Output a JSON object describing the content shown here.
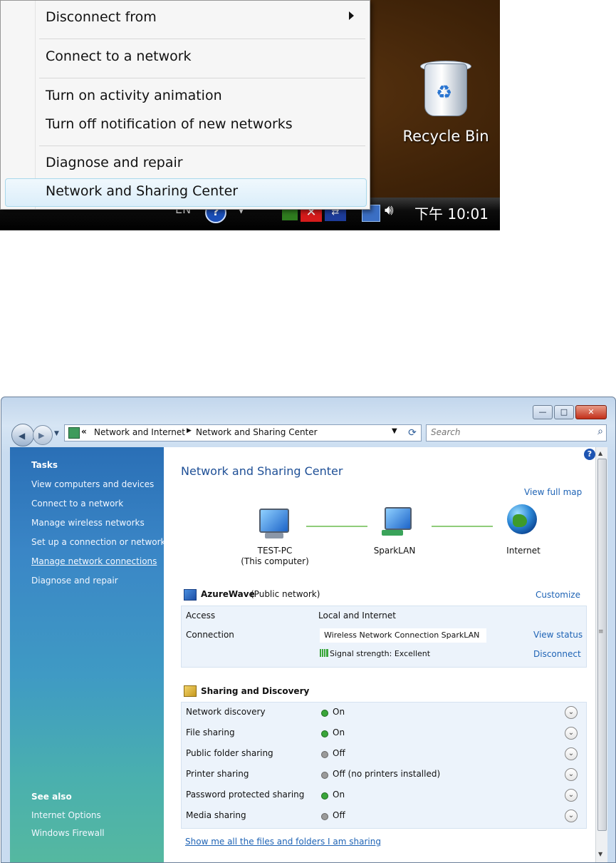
{
  "context_menu": {
    "items": {
      "disconnect_from": "Disconnect from",
      "connect_to_network": "Connect to a network",
      "turn_on_activity": "Turn on activity animation",
      "turn_off_notification": "Turn off notification of new networks",
      "diagnose_repair": "Diagnose and repair",
      "network_sharing_center": "Network and Sharing Center"
    }
  },
  "desktop": {
    "recycle_bin_label": "Recycle Bin"
  },
  "taskbar": {
    "language": "EN",
    "clock": "下午 10:01"
  },
  "window": {
    "address_bar": {
      "crumbs": [
        "Network and Internet",
        "Network and Sharing Center"
      ]
    },
    "search": {
      "placeholder": "Search"
    },
    "sidebar": {
      "tasks_heading": "Tasks",
      "tasks": [
        "View computers and devices",
        "Connect to a network",
        "Manage wireless networks",
        "Set up a connection or network",
        "Manage network connections",
        "Diagnose and repair"
      ],
      "see_also_heading": "See also",
      "see_also": [
        "Internet Options",
        "Windows Firewall"
      ]
    },
    "main": {
      "title": "Network and Sharing Center",
      "view_full_map": "View full map",
      "map_nodes": {
        "computer_name": "TEST-PC",
        "computer_sub": "(This computer)",
        "router": "SparkLAN",
        "internet": "Internet"
      },
      "network": {
        "name": "AzureWave",
        "type": "(Public network)",
        "customize": "Customize",
        "access_label": "Access",
        "access_value": "Local and Internet",
        "connection_label": "Connection",
        "connection_value": "Wireless Network Connection SparkLAN",
        "signal": "Signal strength:  Excellent",
        "view_status": "View status",
        "disconnect": "Disconnect"
      },
      "sharing": {
        "heading": "Sharing and Discovery",
        "rows": [
          {
            "label": "Network discovery",
            "status": "On",
            "state": "on"
          },
          {
            "label": "File sharing",
            "status": "On",
            "state": "on"
          },
          {
            "label": "Public folder sharing",
            "status": "Off",
            "state": "off"
          },
          {
            "label": "Printer sharing",
            "status": "Off (no printers installed)",
            "state": "off"
          },
          {
            "label": "Password protected sharing",
            "status": "On",
            "state": "on"
          },
          {
            "label": "Media sharing",
            "status": "Off",
            "state": "off"
          }
        ]
      },
      "show_all_link": "Show me all the files and folders I am sharing"
    }
  },
  "colors": {
    "link_blue": "#1e63b5",
    "title_blue": "#1e4f96",
    "status_on": "#39a53a",
    "status_off": "#9a9a9a"
  }
}
